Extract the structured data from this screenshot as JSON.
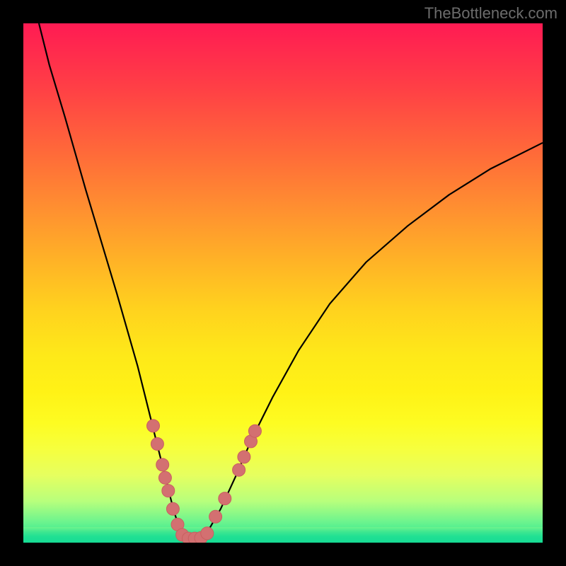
{
  "watermark": "TheBottleneck.com",
  "colors": {
    "frame": "#000000",
    "curve": "#000000",
    "marker_fill": "#d37071",
    "marker_stroke": "#c95f60",
    "gradient_top": "#ff1b53",
    "gradient_bottom": "#16dc94"
  },
  "chart_data": {
    "type": "line",
    "title": "",
    "xlabel": "",
    "ylabel": "",
    "xlim": [
      0,
      100
    ],
    "ylim": [
      0,
      100
    ],
    "series": [
      {
        "name": "bottleneck-curve",
        "x": [
          3,
          5,
          8,
          10,
          12,
          15,
          18,
          20,
          22,
          24,
          26,
          27,
          28,
          29,
          30,
          31,
          32,
          33,
          34,
          36,
          38,
          41,
          44,
          48,
          53,
          59,
          66,
          74,
          82,
          90,
          98,
          100
        ],
        "y": [
          100,
          92,
          82,
          75,
          68,
          58,
          48,
          41,
          34,
          26,
          18,
          14,
          10,
          6,
          3,
          1.5,
          0.8,
          0.8,
          1.5,
          3,
          6.5,
          13,
          20,
          28,
          37,
          46,
          54,
          61,
          67,
          72,
          76,
          77
        ]
      }
    ],
    "markers": [
      {
        "x": 25.0,
        "y": 22.5
      },
      {
        "x": 25.8,
        "y": 19.0
      },
      {
        "x": 26.8,
        "y": 15.0
      },
      {
        "x": 27.3,
        "y": 12.5
      },
      {
        "x": 27.9,
        "y": 10.0
      },
      {
        "x": 28.8,
        "y": 6.5
      },
      {
        "x": 29.7,
        "y": 3.5
      },
      {
        "x": 30.6,
        "y": 1.5
      },
      {
        "x": 31.8,
        "y": 0.8
      },
      {
        "x": 33.0,
        "y": 0.8
      },
      {
        "x": 34.2,
        "y": 0.9
      },
      {
        "x": 35.4,
        "y": 1.8
      },
      {
        "x": 37.0,
        "y": 5.0
      },
      {
        "x": 38.8,
        "y": 8.5
      },
      {
        "x": 41.5,
        "y": 14.0
      },
      {
        "x": 42.5,
        "y": 16.5
      },
      {
        "x": 43.8,
        "y": 19.5
      },
      {
        "x": 44.6,
        "y": 21.5
      }
    ]
  }
}
